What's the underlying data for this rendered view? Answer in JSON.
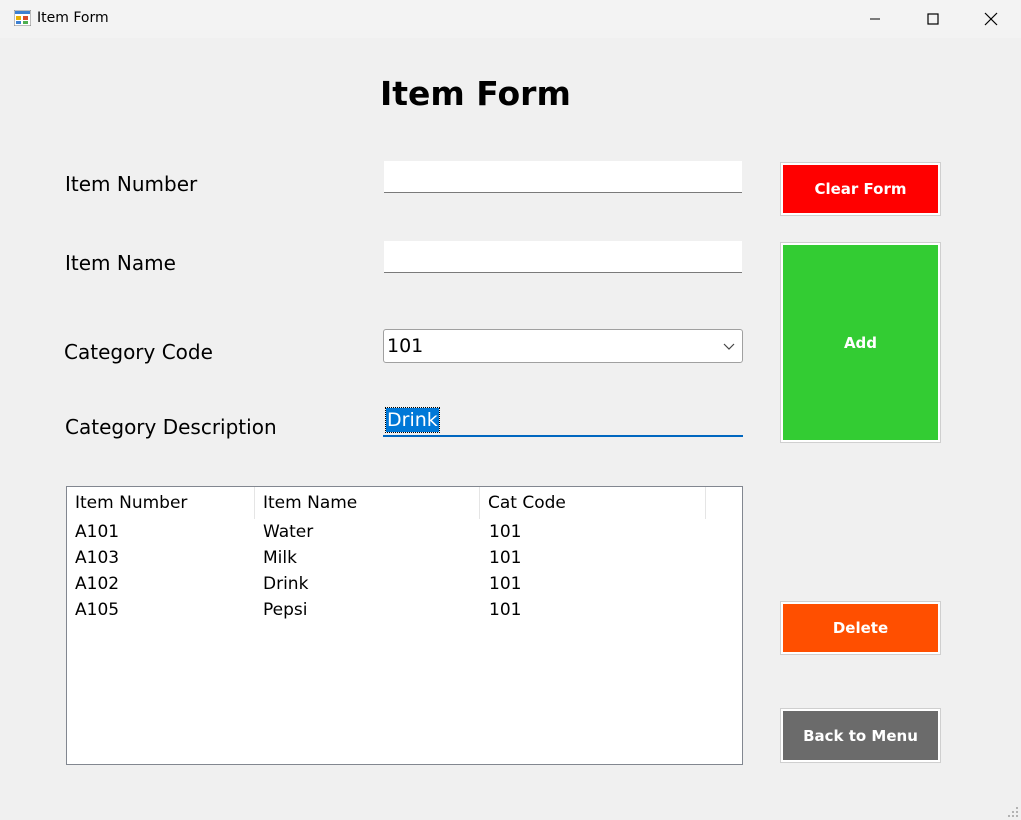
{
  "window": {
    "title": "Item Form"
  },
  "form": {
    "heading": "Item Form",
    "labels": {
      "item_number": "Item Number",
      "item_name": "Item Name",
      "category_code": "Category Code",
      "category_description": "Category Description"
    },
    "fields": {
      "item_number": "",
      "item_name": "",
      "category_code": "101",
      "category_description": "Drink"
    }
  },
  "buttons": {
    "clear": "Clear Form",
    "add": "Add",
    "delete": "Delete",
    "back": "Back to Menu"
  },
  "colors": {
    "clear": "#ff0000",
    "add": "#33cc33",
    "delete": "#ff4f00",
    "back": "#6b6b6b",
    "selection": "#0078d7"
  },
  "table": {
    "columns": [
      "Item Number",
      "Item Name",
      "Cat Code"
    ],
    "rows": [
      [
        "A101",
        "Water",
        "101"
      ],
      [
        "A103",
        "Milk",
        "101"
      ],
      [
        "A102",
        "Drink",
        "101"
      ],
      [
        "A105",
        "Pepsi",
        "101"
      ]
    ]
  }
}
